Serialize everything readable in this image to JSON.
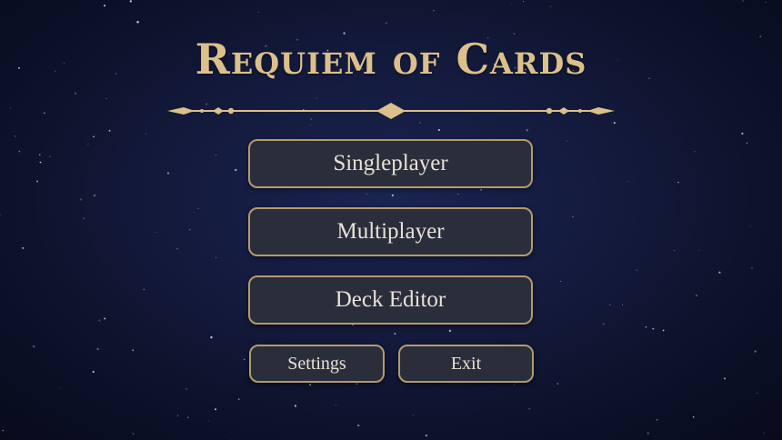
{
  "title": "Requiem of Cards",
  "menu": {
    "singleplayer": "Singleplayer",
    "multiplayer": "Multiplayer",
    "deck_editor": "Deck Editor",
    "settings": "Settings",
    "exit": "Exit"
  },
  "colors": {
    "accent_gold": "#dcc08c",
    "button_fill": "#2a2e3a",
    "button_border": "#b39a6e",
    "button_text": "#e8e2d6",
    "background": "#131a3c"
  }
}
